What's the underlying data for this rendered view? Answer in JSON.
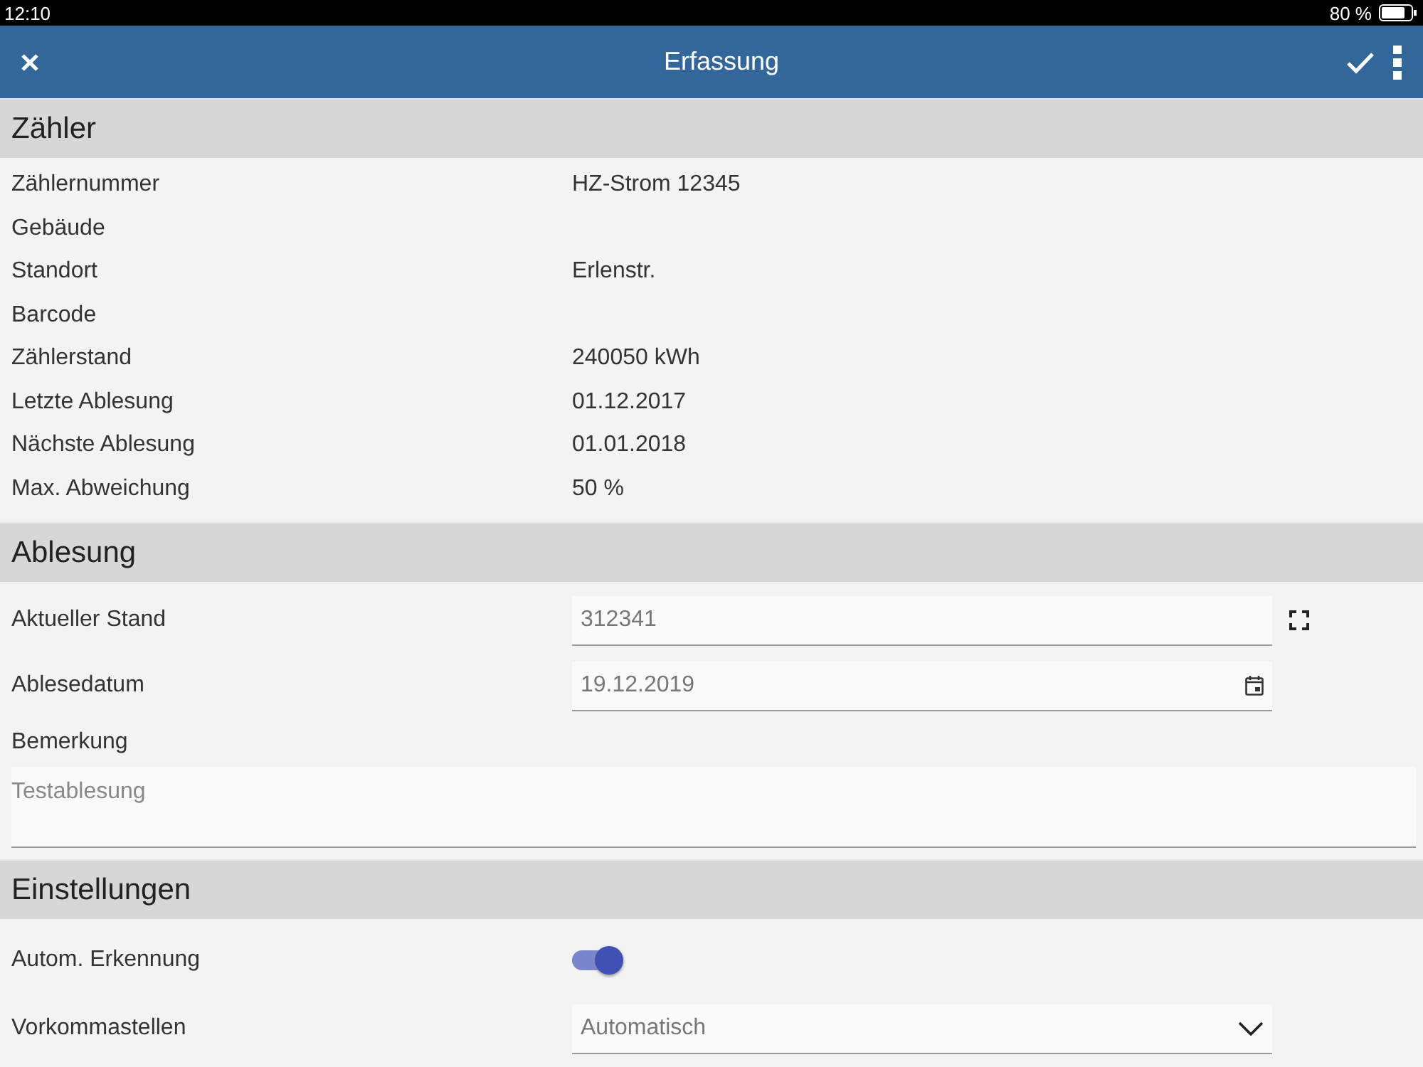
{
  "status_bar": {
    "time": "12:10",
    "battery": "80 %"
  },
  "header": {
    "title": "Erfassung"
  },
  "sections": [
    {
      "title": "Zähler",
      "rows": [
        {
          "kind": "info",
          "label": "Zählernummer",
          "value": "HZ-Strom 12345"
        },
        {
          "kind": "info",
          "label": "Gebäude"
        },
        {
          "kind": "info",
          "label": "Standort",
          "value": "Erlenstr."
        },
        {
          "kind": "info",
          "label": "Barcode"
        },
        {
          "kind": "info",
          "label": "Zählerstand",
          "value": "240050 kWh"
        },
        {
          "kind": "info",
          "label": "Letzte Ablesung",
          "value": "01.12.2017"
        },
        {
          "kind": "info",
          "label": "Nächste Ablesung",
          "value": "01.01.2018"
        },
        {
          "kind": "info",
          "label": "Max. Abweichung",
          "value": "50 %"
        }
      ]
    },
    {
      "title": "Ablesung",
      "rows": [
        {
          "kind": "scan",
          "label": "Aktueller Stand",
          "value": "312341"
        },
        {
          "kind": "date",
          "label": "Ablesedatum",
          "value": "19.12.2019"
        },
        {
          "kind": "textarea",
          "label": "Bemerkung",
          "value": "Testablesung"
        }
      ]
    },
    {
      "title": "Einstellungen",
      "rows": [
        {
          "kind": "toggle",
          "label": "Autom. Erkennung",
          "on": true
        },
        {
          "kind": "select",
          "label": "Vorkommastellen",
          "value": "Automatisch"
        }
      ]
    }
  ]
}
